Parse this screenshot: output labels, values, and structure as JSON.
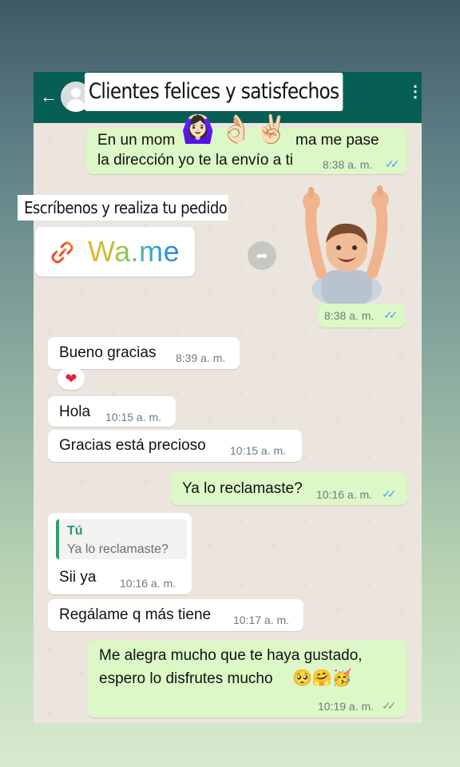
{
  "story": {
    "title": "Clientes felices y satisfechos",
    "cta_text": "Escríbenos y realiza tu pedido",
    "link_label": "Wa.me",
    "sticker_emojis": [
      "🙆🏻‍♀️",
      "👌🏻",
      "✌🏻"
    ]
  },
  "header": {
    "back_icon": "arrow-left-icon",
    "menu_icon": "more-vertical-icon"
  },
  "messages": [
    {
      "id": "m1",
      "direction": "out",
      "lines": [
        "En un mom",
        "la dirección yo te la envío a ti"
      ],
      "line1_end": "ma me pase",
      "time": "8:38 a. m.",
      "ticks": "✓✓",
      "read": true
    },
    {
      "id": "m2",
      "direction": "out",
      "type": "sticker",
      "sticker": "thumbs-up-baby",
      "time": "8:38 a. m.",
      "ticks": "✓✓",
      "read": true
    },
    {
      "id": "m3",
      "direction": "in",
      "text": "Bueno gracias",
      "time": "8:39 a. m.",
      "reaction": "❤"
    },
    {
      "id": "m4",
      "direction": "in",
      "text": "Hola",
      "time": "10:15 a. m."
    },
    {
      "id": "m5",
      "direction": "in",
      "text": "Gracias está precioso",
      "time": "10:15 a. m."
    },
    {
      "id": "m6",
      "direction": "out",
      "text": "Ya lo reclamaste?",
      "time": "10:16 a. m.",
      "ticks": "✓✓",
      "read": true
    },
    {
      "id": "m7",
      "direction": "in",
      "quote_author": "Tú",
      "quote_text": "Ya lo reclamaste?",
      "text": "Sii ya",
      "time": "10:16 a. m."
    },
    {
      "id": "m8",
      "direction": "in",
      "text": "Regálame q más tiene",
      "time": "10:17 a. m."
    },
    {
      "id": "m9",
      "direction": "out",
      "lines": [
        "Me alegra mucho que te haya gustado,",
        "espero lo disfrutes mucho"
      ],
      "emojis": "🥺🤗🥳",
      "time": "10:19 a. m.",
      "ticks": "✓✓",
      "read": false
    }
  ],
  "colors": {
    "header": "#075e54",
    "outgoing_bubble": "#dcf8c6",
    "incoming_bubble": "#ffffff",
    "read_ticks": "#4fa3e4",
    "quote_accent": "#22a56a"
  }
}
